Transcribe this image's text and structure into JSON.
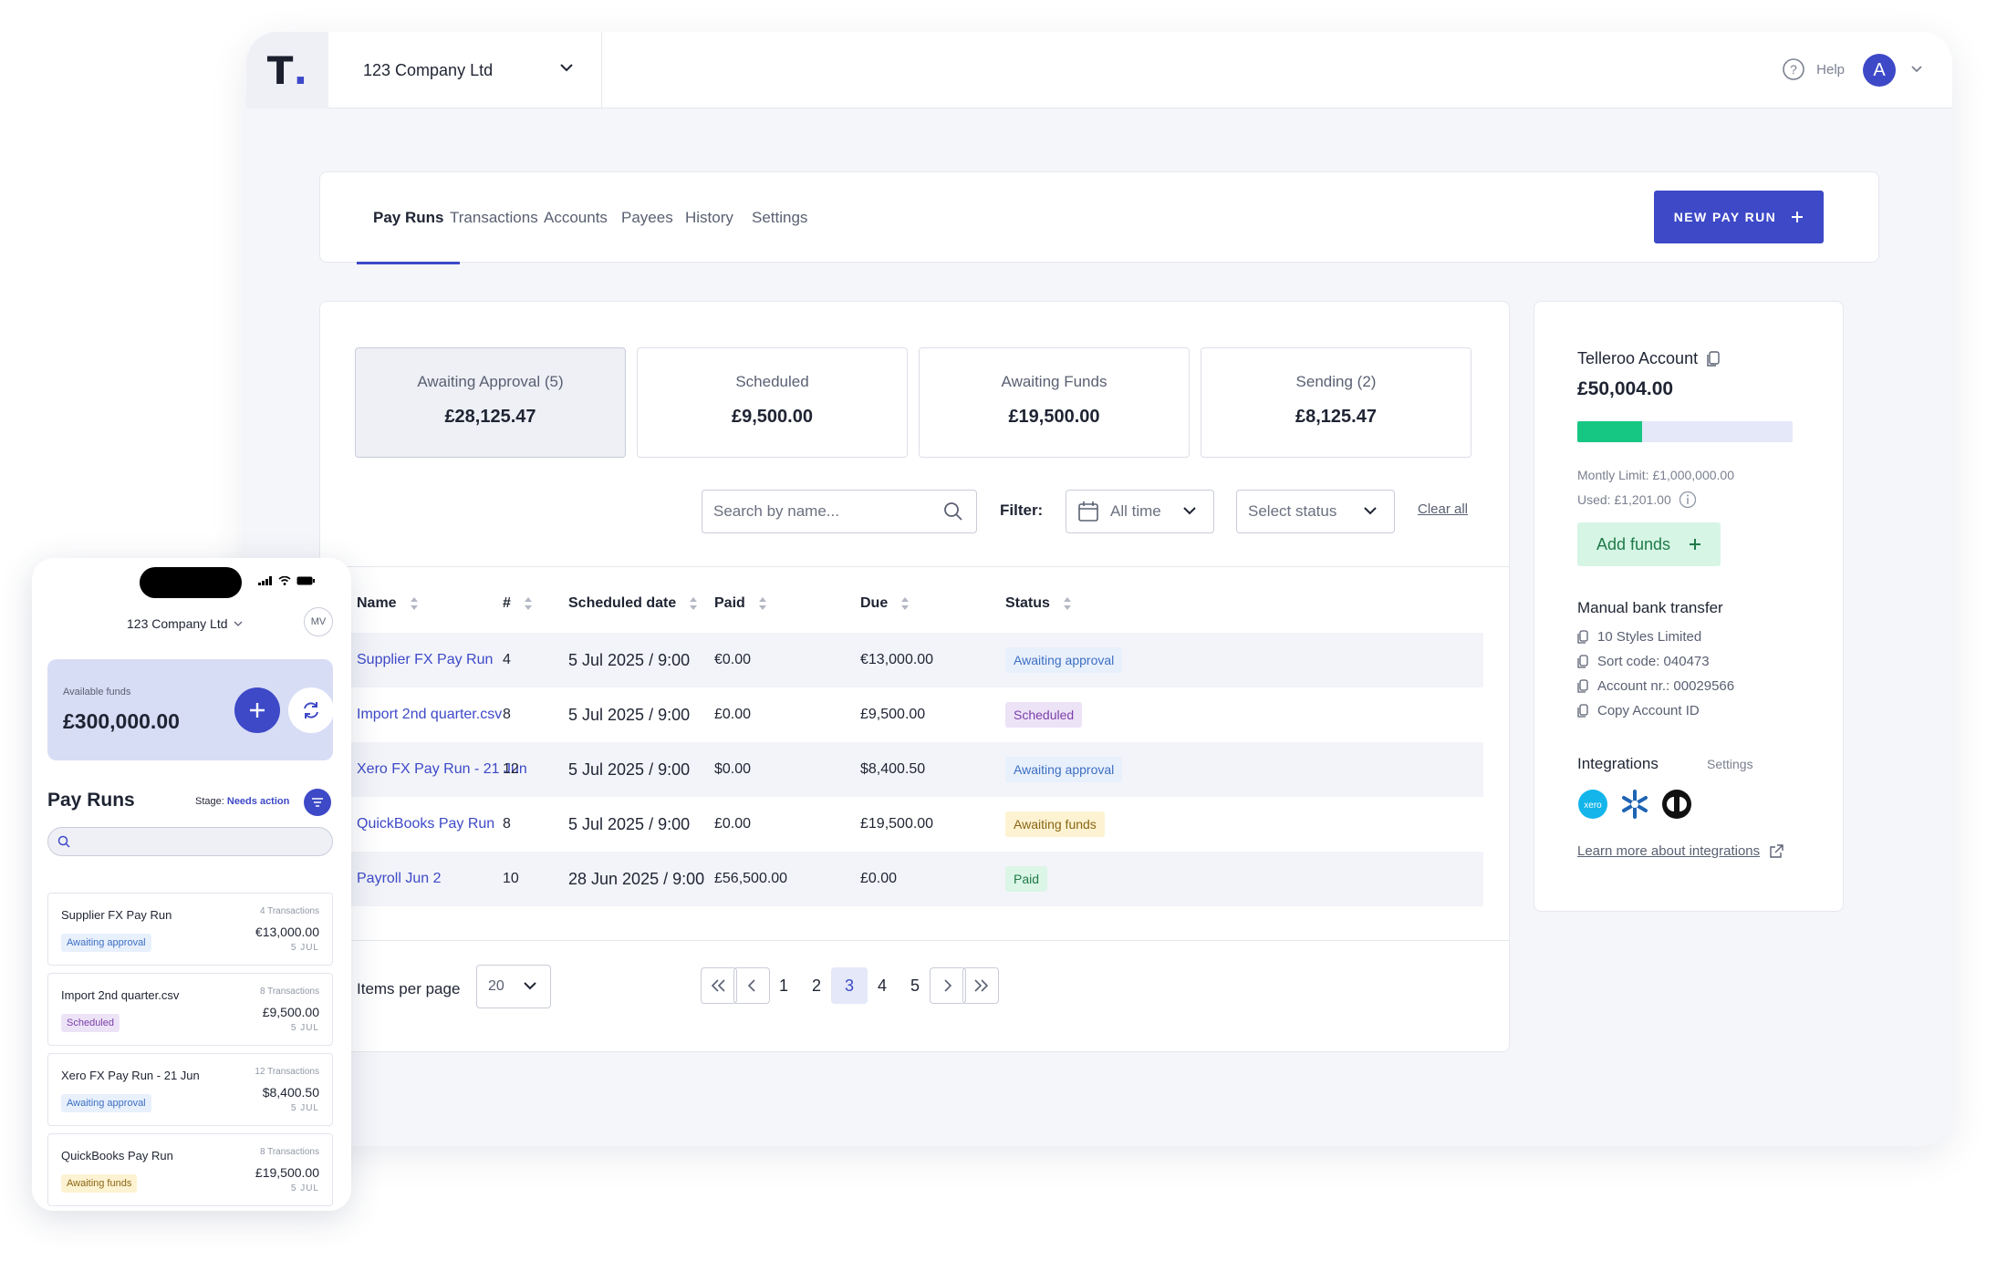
{
  "topbar": {
    "logo": "T",
    "company": "123 Company Ltd",
    "help": "Help",
    "avatar": "A"
  },
  "tabs": [
    "Pay Runs",
    "Transactions",
    "Accounts",
    "Payees",
    "History",
    "Settings"
  ],
  "new_pay_run": "NEW PAY RUN",
  "stats": [
    {
      "label": "Awaiting Approval (5)",
      "value": "£28,125.47"
    },
    {
      "label": "Scheduled",
      "value": "£9,500.00"
    },
    {
      "label": "Awaiting Funds",
      "value": "£19,500.00"
    },
    {
      "label": "Sending (2)",
      "value": "£8,125.47"
    }
  ],
  "filters": {
    "search_placeholder": "Search by name...",
    "filter_label": "Filter:",
    "date": "All time",
    "status": "Select status",
    "clear": "Clear all"
  },
  "table": {
    "headers": [
      "Name",
      "#",
      "Scheduled date",
      "Paid",
      "Due",
      "Status"
    ],
    "rows": [
      {
        "name": "Supplier FX Pay Run",
        "count": "4",
        "date": "5 Jul 2025 / 9:00",
        "paid": "€0.00",
        "due": "€13,000.00",
        "status": "Awaiting approval"
      },
      {
        "name": "Import 2nd quarter.csv",
        "count": "8",
        "date": "5 Jul 2025 / 9:00",
        "paid": "£0.00",
        "due": "£9,500.00",
        "status": "Scheduled"
      },
      {
        "name": "Xero FX Pay Run - 21 Jun",
        "count": "12",
        "date": "5 Jul 2025 / 9:00",
        "paid": "$0.00",
        "due": "$8,400.50",
        "status": "Awaiting approval"
      },
      {
        "name": "QuickBooks Pay Run",
        "count": "8",
        "date": "5 Jul 2025 / 9:00",
        "paid": "£0.00",
        "due": "£19,500.00",
        "status": "Awaiting funds"
      },
      {
        "name": "Payroll Jun 2",
        "count": "10",
        "date": "28 Jun 2025 / 9:00",
        "paid": "£56,500.00",
        "due": "£0.00",
        "status": "Paid"
      }
    ]
  },
  "pagination": {
    "items_label": "Items per page",
    "per_page": "20",
    "pages": [
      "1",
      "2",
      "3",
      "4",
      "5"
    ],
    "current": "3"
  },
  "account": {
    "title": "Telleroo Account",
    "balance": "£50,004.00",
    "used_fraction": 0.3,
    "limit": "Montly Limit: £1,000,000.00",
    "used": "Used: £1,201.00",
    "add_funds": "Add funds",
    "manual_title": "Manual bank transfer",
    "manual_lines": [
      "10 Styles Limited",
      "Sort code: 040473",
      "Account nr.: 00029566",
      "Copy Account ID"
    ],
    "integrations_title": "Integrations",
    "integrations_settings": "Settings",
    "xero": "xero",
    "learn_more": "Learn more about integrations"
  },
  "phone": {
    "company": "123 Company Ltd",
    "initials": "MV",
    "funds_label": "Available funds",
    "funds_value": "£300,000.00",
    "title": "Pay Runs",
    "stage_label": "Stage:",
    "stage_value": "Needs action",
    "items": [
      {
        "name": "Supplier FX Pay Run",
        "tx": "4 Transactions",
        "amount": "€13,000.00",
        "date": "5 JUL",
        "status": "Awaiting approval"
      },
      {
        "name": "Import 2nd quarter.csv",
        "tx": "8 Transactions",
        "amount": "£9,500.00",
        "date": "5 JUL",
        "status": "Scheduled"
      },
      {
        "name": "Xero FX Pay Run - 21 Jun",
        "tx": "12 Transactions",
        "amount": "$8,400.50",
        "date": "5 JUL",
        "status": "Awaiting approval"
      },
      {
        "name": "QuickBooks Pay Run",
        "tx": "8 Transactions",
        "amount": "£19,500.00",
        "date": "5 JUL",
        "status": "Awaiting funds"
      }
    ]
  },
  "colors": {
    "primary": "#3d49c7",
    "green": "#16c784",
    "background": "#f5f6fa"
  }
}
